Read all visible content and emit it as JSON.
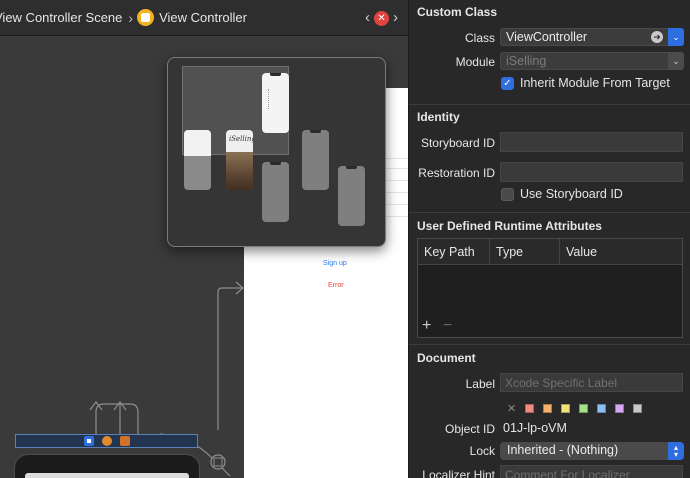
{
  "jumpbar": {
    "scene_label": "View Controller Scene",
    "controller_label": "View Controller",
    "back_glyph": "‹",
    "forward_glyph": "›",
    "close_glyph": "✕"
  },
  "canvas": {
    "signup_label": "Sign up",
    "error_label": "Error"
  },
  "minimap": {
    "app_title": "iSelling"
  },
  "inspector": {
    "custom_class": {
      "title": "Custom Class",
      "class_label": "Class",
      "class_value": "ViewController",
      "module_label": "Module",
      "module_value": "iSelling",
      "inherit_label": "Inherit Module From Target",
      "inherit_checked": true
    },
    "identity": {
      "title": "Identity",
      "storyboard_id_label": "Storyboard ID",
      "storyboard_id_value": "",
      "restoration_id_label": "Restoration ID",
      "restoration_id_value": "",
      "use_storyboard_id_label": "Use Storyboard ID",
      "use_storyboard_id_checked": false
    },
    "runtime_attributes": {
      "title": "User Defined Runtime Attributes",
      "columns": [
        "Key Path",
        "Type",
        "Value"
      ],
      "add_glyph": "+",
      "remove_glyph": "−"
    },
    "document": {
      "title": "Document",
      "label_label": "Label",
      "label_placeholder": "Xcode Specific Label",
      "swatch_clear_glyph": "✕",
      "swatch_colors": [
        "#f28b82",
        "#f6b26b",
        "#f3e27a",
        "#a8e08a",
        "#8cbff2",
        "#d6a6f0",
        "#c8c8c8"
      ],
      "object_id_label": "Object ID",
      "object_id_value": "01J-lp-oVM",
      "lock_label": "Lock",
      "lock_value": "Inherited - (Nothing)",
      "localizer_hint_label": "Localizer Hint",
      "localizer_hint_placeholder": "Comment For Localizer"
    }
  }
}
